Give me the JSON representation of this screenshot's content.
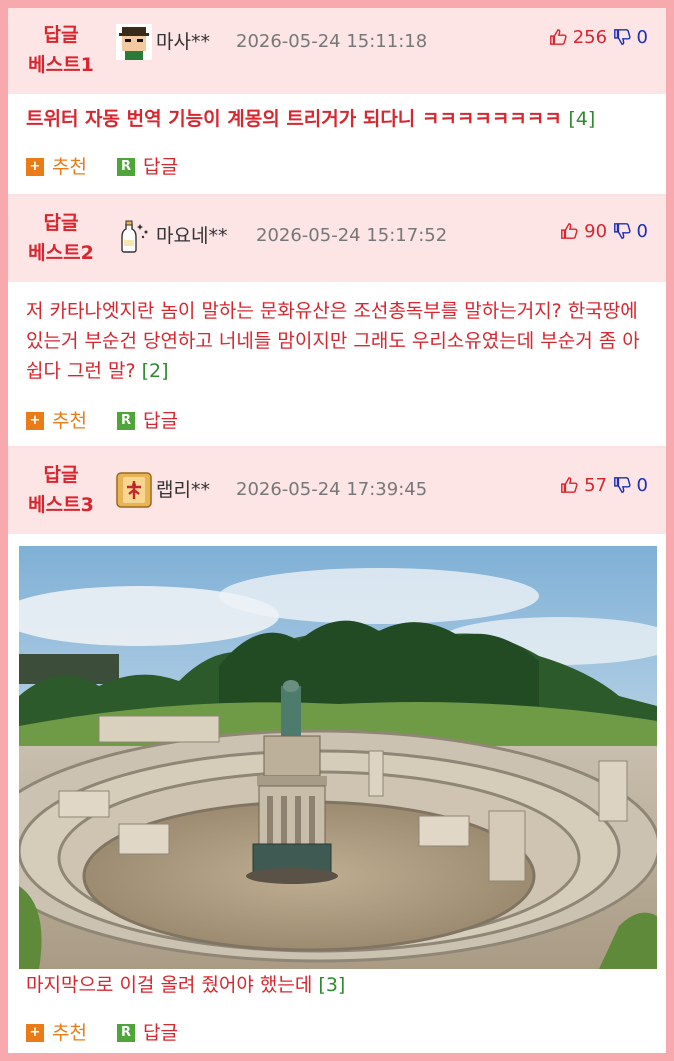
{
  "actions": {
    "recommend_label": "추천",
    "reply_label": "답글",
    "plus_glyph": "+",
    "r_glyph": "R"
  },
  "comments": [
    {
      "best_line1": "답글",
      "best_line2": "베스트1",
      "nickname": "마사**",
      "date": "2026-05-24 15:11:18",
      "up": "256",
      "down": "0",
      "avatar_icon": "pixel-person-avatar",
      "text": "트위터 자동 번역 기능이 계몽의 트리거가 되다니 ㅋㅋㅋㅋㅋㅋㅋㅋ",
      "reply_count": "[4]"
    },
    {
      "best_line1": "답글",
      "best_line2": "베스트2",
      "nickname": "마요네**",
      "date": "2026-05-24 15:17:52",
      "up": "90",
      "down": "0",
      "avatar_icon": "bottle-avatar",
      "text": "저 카타나엣지란 놈이 말하는 문화유산은 조선총독부를 말하는거지? 한국땅에 있는거 부순건 당연하고 너네들 맘이지만 그래도 우리소유였는데 부순거 좀 아쉽다 그런 말?",
      "reply_count": "[2]"
    },
    {
      "best_line1": "답글",
      "best_line2": "베스트3",
      "nickname": "랩리**",
      "date": "2026-05-24 17:39:45",
      "up": "57",
      "down": "0",
      "avatar_icon": "mahjong-tile-avatar",
      "photo": "circular-stone-ruins-photo",
      "text": "마지막으로 이걸 올려 줬어야 했는데",
      "reply_count": "[3]"
    }
  ],
  "colors": {
    "accent": "#d8262f",
    "frame": "#f7a9ae",
    "header_bg": "#fde4e5",
    "count": "#2f8a2f",
    "down": "#1c2fb8"
  }
}
